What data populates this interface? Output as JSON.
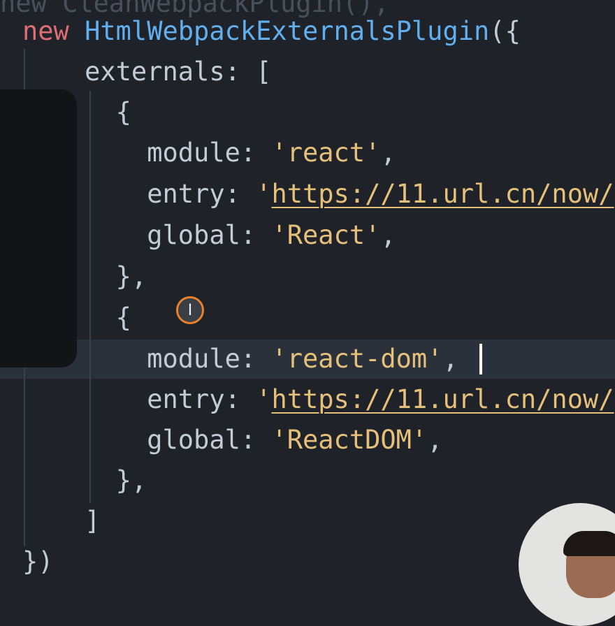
{
  "code": {
    "lines": {
      "l0": {
        "t1": "new ",
        "t2": "CleanWebpackPlugin",
        "t3": "(),"
      },
      "l1": {
        "kw": "new ",
        "cls": "HtmlWebpackExternalsPlugin",
        "punc": "({"
      },
      "l2": {
        "indent": "    ",
        "prop": "externals",
        "punc": ": ["
      },
      "l3": {
        "indent": "      ",
        "punc": "{"
      },
      "l4": {
        "indent": "        ",
        "prop": "module",
        "colon": ": ",
        "str": "'react'",
        "tail": ","
      },
      "l5": {
        "indent": "        ",
        "prop": "entry",
        "colon": ": ",
        "q": "'",
        "url": "https://11.url.cn/now/"
      },
      "l6": {
        "indent": "        ",
        "prop": "global",
        "colon": ": ",
        "str": "'React'",
        "tail": ","
      },
      "l7": {
        "indent": "      ",
        "punc": "},"
      },
      "l8": {
        "indent": "      ",
        "punc": "{"
      },
      "l9": {
        "indent": "        ",
        "prop": "module",
        "colon": ": ",
        "str": "'react-dom'",
        "tail": ","
      },
      "l10": {
        "indent": "        ",
        "prop": "entry",
        "colon": ": ",
        "q": "'",
        "url": "https://11.url.cn/now/"
      },
      "l11": {
        "indent": "        ",
        "prop": "global",
        "colon": ": ",
        "str": "'ReactDOM'",
        "tail": ","
      },
      "l12": {
        "indent": "      ",
        "punc": "},"
      },
      "l13": {
        "indent": "    ",
        "punc": "]"
      },
      "l14": {
        "indent": "",
        "punc": "})"
      }
    }
  },
  "cursor": {
    "glyph": "I",
    "icon": "text-cursor-icon"
  },
  "colors": {
    "keyword": "#e06c75",
    "class": "#61afef",
    "string": "#e5c07b",
    "text": "#c5cbd4",
    "background": "#1f2329"
  }
}
